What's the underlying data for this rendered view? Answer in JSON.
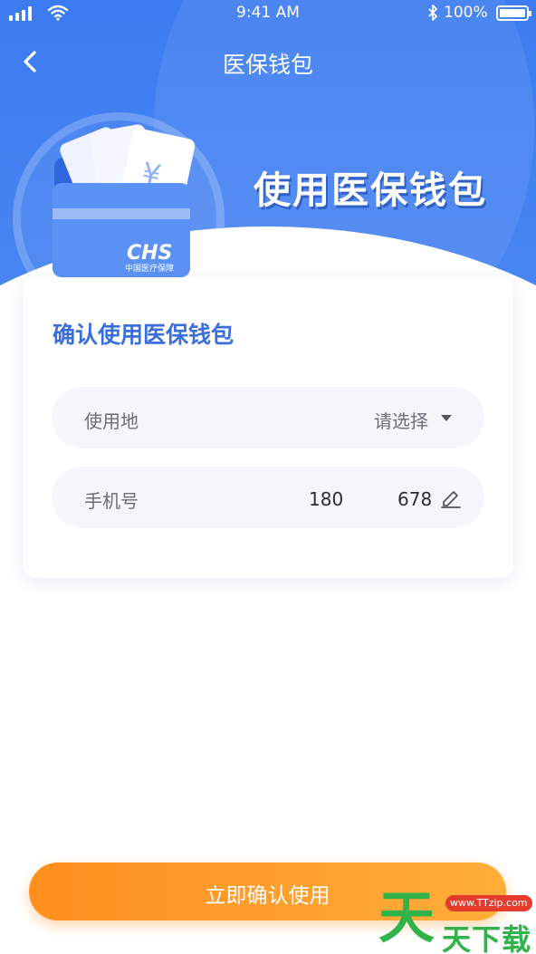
{
  "status_bar": {
    "time": "9:41 AM",
    "battery": "100%",
    "icons": [
      "signal-icon",
      "wifi-icon",
      "bluetooth-icon",
      "battery-icon"
    ]
  },
  "nav": {
    "title": "医保钱包",
    "back_icon": "chevron-left-icon"
  },
  "hero": {
    "title": "使用医保钱包",
    "logo_text": "CHS",
    "logo_subtext": "中国医疗保障",
    "yuan_symbol": "¥"
  },
  "card": {
    "title": "确认使用医保钱包",
    "location": {
      "label": "使用地",
      "placeholder": "请选择",
      "icon": "caret-down-icon"
    },
    "phone": {
      "label": "手机号",
      "value_prefix": "180",
      "value_suffix": "678",
      "icon": "edit-pencil-icon"
    }
  },
  "confirm_button": {
    "label": "立即确认使用"
  },
  "watermark": {
    "big_char": "天",
    "badge": "www.TTzip.com",
    "text": "天下载"
  },
  "colors": {
    "hero_blue": "#3c7cf0",
    "title_blue": "#3a6fdb",
    "button_orange": "#ff9a28",
    "watermark_green": "#2fb34a"
  }
}
